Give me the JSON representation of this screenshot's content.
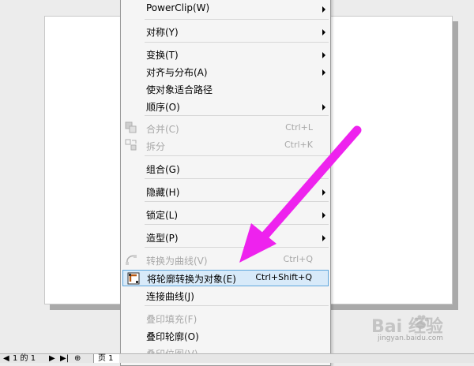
{
  "menu": {
    "items": {
      "powerclip": {
        "label": "PowerClip(W)",
        "submenu": true
      },
      "symmetry": {
        "label": "对称(Y)",
        "submenu": true
      },
      "transform": {
        "label": "变换(T)",
        "submenu": true
      },
      "align": {
        "label": "对齐与分布(A)",
        "submenu": true
      },
      "fit_path": {
        "label": "使对象适合路径"
      },
      "order": {
        "label": "顺序(O)",
        "submenu": true
      },
      "combine": {
        "label": "合并(C)",
        "shortcut": "Ctrl+L",
        "disabled": true
      },
      "break_apart": {
        "label": "拆分",
        "shortcut": "Ctrl+K",
        "disabled": true
      },
      "group": {
        "label": "组合(G)"
      },
      "hide": {
        "label": "隐藏(H)",
        "submenu": true
      },
      "lock": {
        "label": "锁定(L)",
        "submenu": true
      },
      "shaping": {
        "label": "造型(P)",
        "submenu": true
      },
      "to_curves": {
        "label": "转换为曲线(V)",
        "shortcut": "Ctrl+Q",
        "disabled": true
      },
      "outline_to_obj": {
        "label": "将轮廓转换为对象(E)",
        "shortcut": "Ctrl+Shift+Q",
        "highlighted": true
      },
      "join_curves": {
        "label": "连接曲线(J)"
      },
      "overprint_fill": {
        "label": "叠印填充(F)",
        "disabled": true
      },
      "overprint_outline": {
        "label": "叠印轮廓(O)"
      },
      "overprint_bitmap": {
        "label": "叠印位图(V)",
        "disabled": true
      }
    }
  },
  "pagebar": {
    "first_text": "1 的 1",
    "tab": "页 1"
  },
  "watermark": {
    "logo": "Bai  经验",
    "sub": "jingyan.baidu.com"
  },
  "colors": {
    "annotation_arrow": "#ee22ee",
    "highlight_fill": "#d8eaf9",
    "highlight_border": "#5ea6dc"
  }
}
